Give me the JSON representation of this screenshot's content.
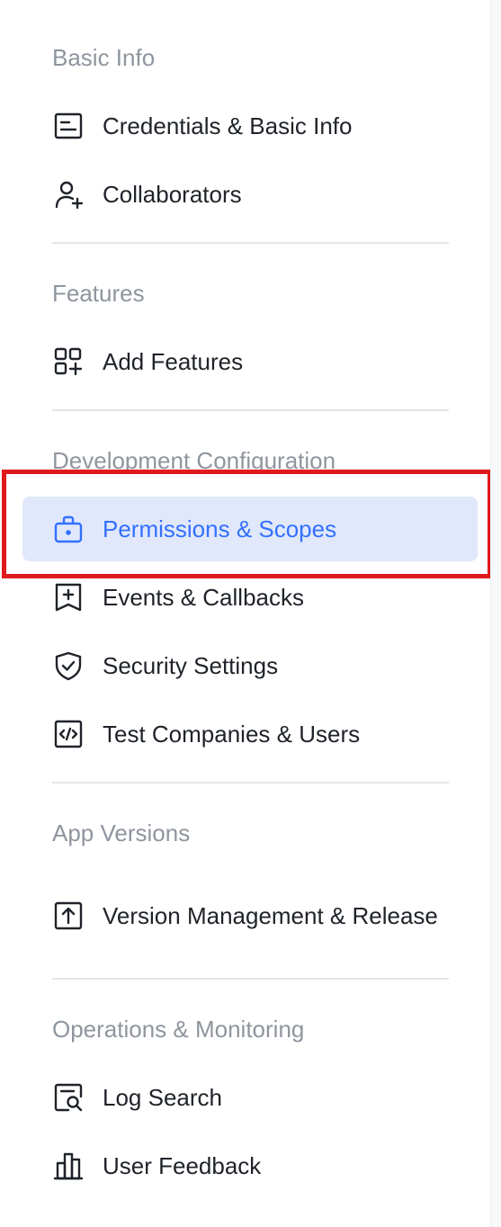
{
  "sections": [
    {
      "title": "Basic Info",
      "items": [
        {
          "label": "Credentials & Basic Info",
          "icon": "id-card-icon"
        },
        {
          "label": "Collaborators",
          "icon": "user-add-icon"
        }
      ]
    },
    {
      "title": "Features",
      "items": [
        {
          "label": "Add Features",
          "icon": "grid-add-icon"
        }
      ]
    },
    {
      "title": "Development Configuration",
      "items": [
        {
          "label": "Permissions & Scopes",
          "icon": "briefcase-lock-icon",
          "active": true
        },
        {
          "label": "Events & Callbacks",
          "icon": "bookmark-plus-icon"
        },
        {
          "label": "Security Settings",
          "icon": "shield-check-icon"
        },
        {
          "label": "Test Companies & Users",
          "icon": "code-box-icon"
        }
      ]
    },
    {
      "title": "App Versions",
      "items": [
        {
          "label": "Version Management & Release",
          "icon": "upload-box-icon"
        }
      ]
    },
    {
      "title": "Operations & Monitoring",
      "items": [
        {
          "label": "Log Search",
          "icon": "document-search-icon"
        },
        {
          "label": "User Feedback",
          "icon": "bar-chart-icon"
        }
      ]
    }
  ],
  "colors": {
    "active_background": "#e1e8fb",
    "active_text": "#3370ff",
    "text": "#1f2329",
    "section_title": "#8f959e",
    "highlight_border": "#e0191c"
  }
}
